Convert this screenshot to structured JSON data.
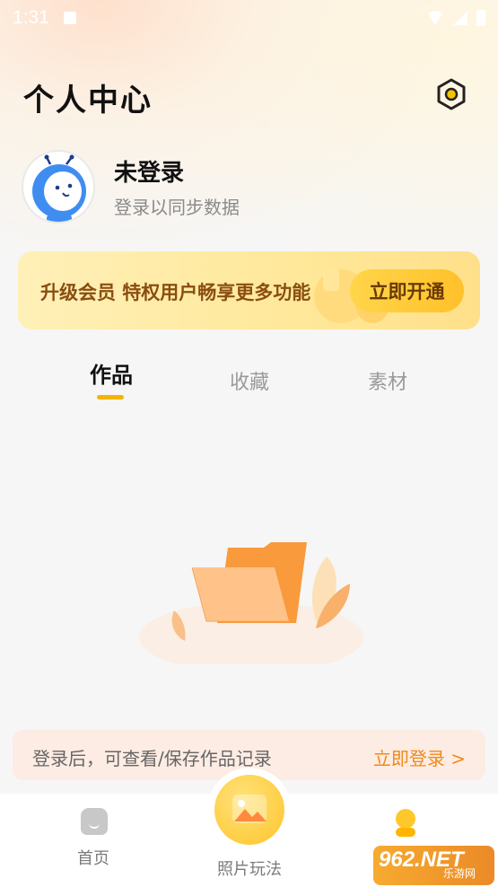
{
  "status_bar": {
    "time": "1:31"
  },
  "header": {
    "title": "个人中心",
    "settings_icon": "settings-hexagon-icon"
  },
  "profile": {
    "name": "未登录",
    "subtitle": "登录以同步数据",
    "avatar_icon": "ant-mascot-avatar"
  },
  "vip_banner": {
    "text": "升级会员 特权用户畅享更多功能",
    "button": "立即开通"
  },
  "tabs": [
    {
      "label": "作品",
      "active": true
    },
    {
      "label": "收藏",
      "active": false
    },
    {
      "label": "素材",
      "active": false
    }
  ],
  "empty_state": {
    "icon": "empty-folder-icon"
  },
  "login_bar": {
    "hint": "登录后，可查看/保存作品记录",
    "link": "立即登录 >"
  },
  "bottom_nav": {
    "items": [
      {
        "label": "首页",
        "icon": "home-icon"
      },
      {
        "label": "照片玩法",
        "icon": "photo-play-icon"
      },
      {
        "label": "",
        "icon": "mine-icon"
      }
    ]
  },
  "watermark": {
    "main": "962.NET",
    "sub": "乐游网"
  },
  "colors": {
    "accent": "#f5b400",
    "link": "#ef8a1a",
    "vip_text": "#8a4e10"
  }
}
